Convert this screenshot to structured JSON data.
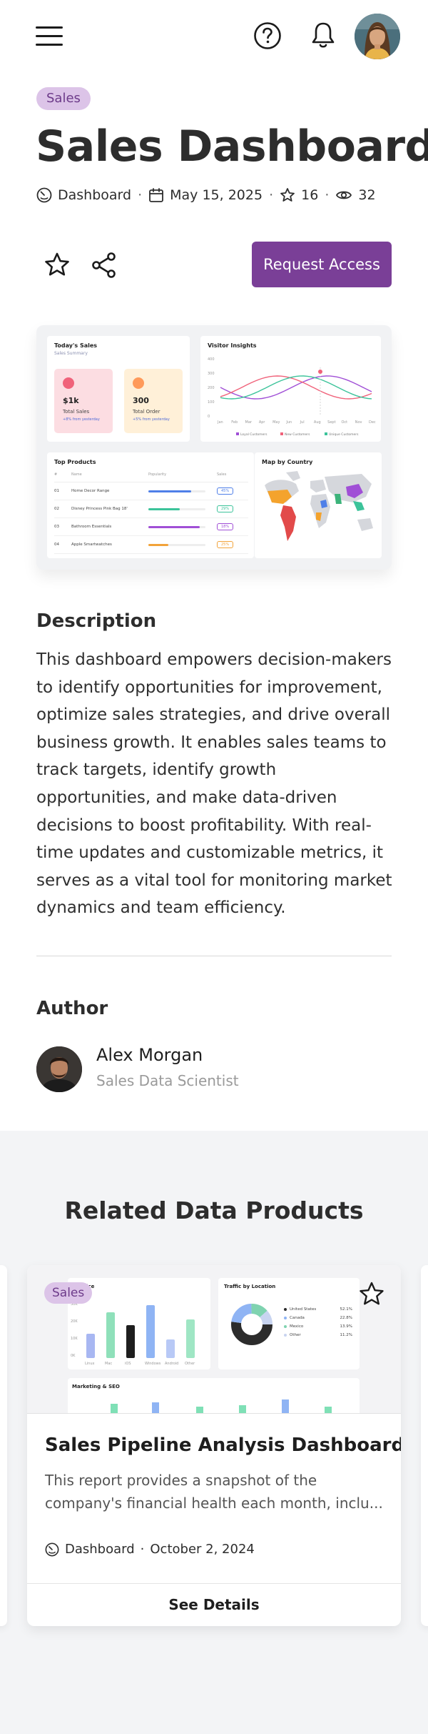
{
  "header": {
    "menu_icon": "hamburger-menu-icon",
    "help_icon": "help-circle-icon",
    "notification_icon": "bell-icon",
    "avatar": "user-avatar"
  },
  "product": {
    "badge": "Sales",
    "title": "Sales Dashboard",
    "type": "Dashboard",
    "date": "May 15, 2025",
    "stars": "16",
    "views": "32",
    "request_access_label": "Request Access"
  },
  "preview": {
    "todays_sales": {
      "title": "Today's Sales",
      "subtitle": "Sales Summary",
      "cards": [
        {
          "value": "$1k",
          "label": "Total Sales",
          "note": "+8% from yesterday"
        },
        {
          "value": "300",
          "label": "Total Order",
          "note": "+5% from yesterday"
        }
      ]
    },
    "visitor_insights": {
      "title": "Visitor Insights",
      "months": [
        "Jan",
        "Feb",
        "Mar",
        "Apr",
        "May",
        "Jun",
        "Jul",
        "Aug",
        "Sept",
        "Oct",
        "Nov",
        "Dec"
      ],
      "y_ticks": [
        "400",
        "300",
        "200",
        "100",
        "0"
      ],
      "legend": [
        "Loyal Customers",
        "New Customers",
        "Unique Customers"
      ]
    },
    "top_products": {
      "title": "Top Products",
      "columns": [
        "#",
        "Name",
        "Popularity",
        "Sales"
      ],
      "rows": [
        {
          "num": "01",
          "name": "Home Decor Range",
          "pct": "45%",
          "color": "#4f7fe8",
          "fill": 0.75
        },
        {
          "num": "02",
          "name": "Disney Princess Pink Bag 18'",
          "pct": "29%",
          "color": "#3cc39a",
          "fill": 0.55
        },
        {
          "num": "03",
          "name": "Bathroom Essentials",
          "pct": "18%",
          "color": "#a04fd6",
          "fill": 0.9
        },
        {
          "num": "04",
          "name": "Apple Smartwatches",
          "pct": "25%",
          "color": "#f2a33a",
          "fill": 0.35
        }
      ]
    },
    "map_by_country": {
      "title": "Map by Country"
    }
  },
  "description": {
    "heading": "Description",
    "text": "This dashboard empowers decision-makers to identify opportunities for improvement, optimize sales strategies, and drive overall business growth. It enables sales teams to track targets, identify growth opportunities, and make data-driven decisions to boost profitability. With real-time updates and customizable metrics, it serves as a vital tool for monitoring market dynamics and team efficiency."
  },
  "author": {
    "heading": "Author",
    "name": "Alex Morgan",
    "role": "Sales Data Scientist"
  },
  "related": {
    "heading": "Related Data Products",
    "cards": [
      {
        "badge": "Sales",
        "title": "Sales Pipeline Analysis Dashboard",
        "description": "This report provides a snapshot of the company's financial health each month, inclu...",
        "type": "Dashboard",
        "date": "October 2, 2024",
        "cta": "See Details",
        "preview": {
          "device_title": "y Device",
          "device_ticks": [
            "30K",
            "20K",
            "10K",
            "0K"
          ],
          "device_labels": [
            "Linux",
            "Mac",
            "iOS",
            "Windows",
            "Android",
            "Other"
          ],
          "location_title": "Traffic by Location",
          "locations": [
            {
              "name": "United States",
              "value": "52.1%"
            },
            {
              "name": "Canada",
              "value": "22.8%"
            },
            {
              "name": "Mexico",
              "value": "13.9%"
            },
            {
              "name": "Other",
              "value": "11.2%"
            }
          ],
          "marketing_title": "Marketing & SEO"
        }
      }
    ]
  },
  "colors": {
    "accent": "#7a3f97",
    "badge_bg": "#dcc4e8",
    "badge_text": "#6d3b8a"
  }
}
